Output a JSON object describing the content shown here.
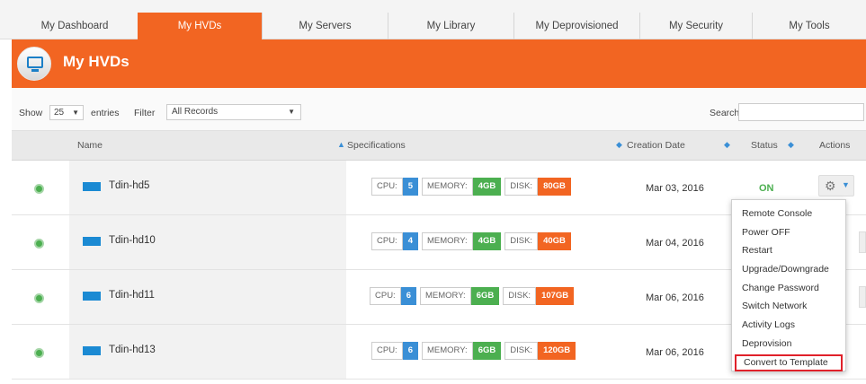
{
  "tabs": [
    {
      "label": "My Dashboard",
      "active": false
    },
    {
      "label": "My HVDs",
      "active": true
    },
    {
      "label": "My Servers",
      "active": false
    },
    {
      "label": "My Library",
      "active": false
    },
    {
      "label": "My Deprovisioned",
      "active": false
    },
    {
      "label": "My Security",
      "active": false
    },
    {
      "label": "My Tools",
      "active": false
    }
  ],
  "banner": {
    "title": "My HVDs",
    "icon": "monitor-icon"
  },
  "filters": {
    "show_label": "Show",
    "page_size": "25",
    "entries_label": "entries",
    "filter_label": "Filter",
    "filter_value": "All Records",
    "search_label": "Search:",
    "search_value": ""
  },
  "columns": {
    "name": "Name",
    "specs": "Specifications",
    "created": "Creation Date",
    "status": "Status",
    "actions": "Actions"
  },
  "spec_labels": {
    "cpu": "CPU:",
    "memory": "MEMORY:",
    "disk": "DISK:"
  },
  "rows": [
    {
      "name": "Tdin-hd5",
      "cpu": "5",
      "memory": "4GB",
      "disk": "80GB",
      "created": "Mar 03, 2016",
      "status": "ON"
    },
    {
      "name": "Tdin-hd10",
      "cpu": "4",
      "memory": "4GB",
      "disk": "40GB",
      "created": "Mar 04, 2016",
      "status": ""
    },
    {
      "name": "Tdin-hd11",
      "cpu": "6",
      "memory": "6GB",
      "disk": "107GB",
      "created": "Mar 06, 2016",
      "status": ""
    },
    {
      "name": "Tdin-hd13",
      "cpu": "6",
      "memory": "6GB",
      "disk": "120GB",
      "created": "Mar 06, 2016",
      "status": ""
    }
  ],
  "actions_menu": [
    "Remote Console",
    "Power OFF",
    "Restart",
    "Upgrade/Downgrade",
    "Change Password",
    "Switch Network",
    "Activity Logs",
    "Deprovision",
    "Convert to Template"
  ],
  "colors": {
    "accent": "#f26522",
    "cpu": "#3a8fd6",
    "memory": "#4caf50",
    "disk": "#f26522",
    "highlight": "#e0212a"
  }
}
